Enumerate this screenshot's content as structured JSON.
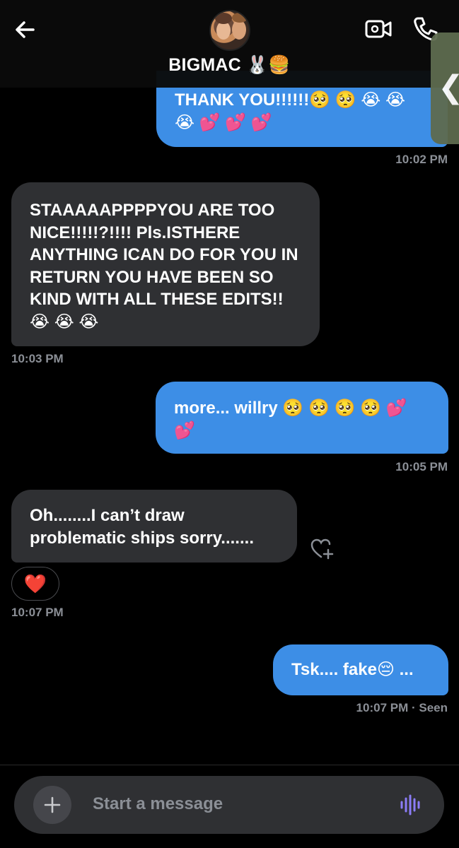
{
  "header": {
    "contact_name": "BIGMAC 🐰🍔",
    "icons": [
      "back-arrow-icon",
      "video-call-icon",
      "phone-call-icon"
    ]
  },
  "side_tab": {
    "glyph": "❮"
  },
  "messages": [
    {
      "id": "m1",
      "direction": "sent",
      "text": "THANK YOU!!!!!!🥺 🥺 😭 😭 😭 💕 💕 💕",
      "time": "10:02 PM"
    },
    {
      "id": "m2",
      "direction": "received",
      "text": "STAAAAAPPPPYOU ARE TOO NICE!!!!!?!!!! Pls.ISTHERE ANYTHING ICAN DO FOR YOU IN RETURN YOU HAVE BEEN SO KIND WITH ALL THESE EDITS!!😭 😭 😭",
      "time": "10:03 PM"
    },
    {
      "id": "m3",
      "direction": "sent",
      "text": "more... willry 🥺 🥺 🥺 🥺 💕 💕",
      "time": "10:05 PM"
    },
    {
      "id": "m4",
      "direction": "received",
      "text": "Oh........I can’t draw problematic ships sorry.......",
      "time": "10:07 PM",
      "reaction": "❤️"
    },
    {
      "id": "m5",
      "direction": "sent",
      "text": "Tsk.... fake😔 ...",
      "time": "10:07 PM · Seen"
    }
  ],
  "composer": {
    "placeholder": "Start a message",
    "icons": [
      "plus-icon",
      "voice-message-icon"
    ]
  },
  "colors": {
    "sent_bubble": "#3d8ee6",
    "received_bubble": "#2f3033",
    "background": "#000000",
    "voice_icon": "#8b7cf6"
  }
}
